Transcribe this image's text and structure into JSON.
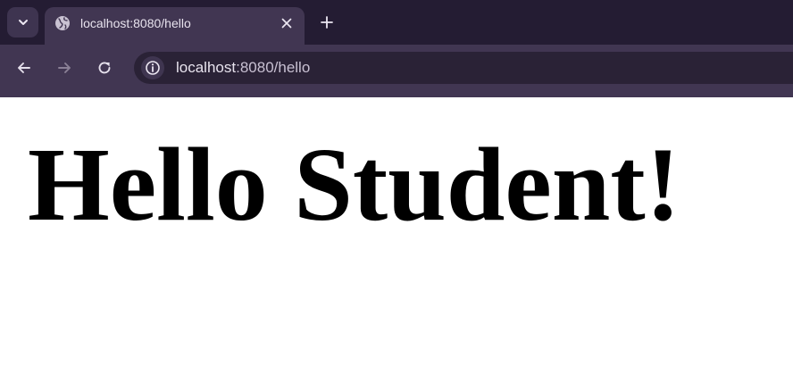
{
  "tab": {
    "title": "localhost:8080/hello",
    "favicon_icon": "globe-icon",
    "close_icon": "close-icon"
  },
  "tabstrip": {
    "tab_search_icon": "chevron-down-icon",
    "new_tab_icon": "plus-icon"
  },
  "toolbar": {
    "back_icon": "arrow-left-icon",
    "forward_icon": "arrow-right-icon",
    "reload_icon": "reload-icon",
    "site_info_icon": "info-icon"
  },
  "omnibox": {
    "host": "localhost",
    "path": ":8080/hello"
  },
  "page": {
    "heading": "Hello Student!"
  },
  "colors": {
    "tabstrip_bg": "#241c33",
    "active_tab_bg": "#413652",
    "omnibox_bg": "#2a2236",
    "page_bg": "#ffffff",
    "heading_color": "#000000"
  }
}
